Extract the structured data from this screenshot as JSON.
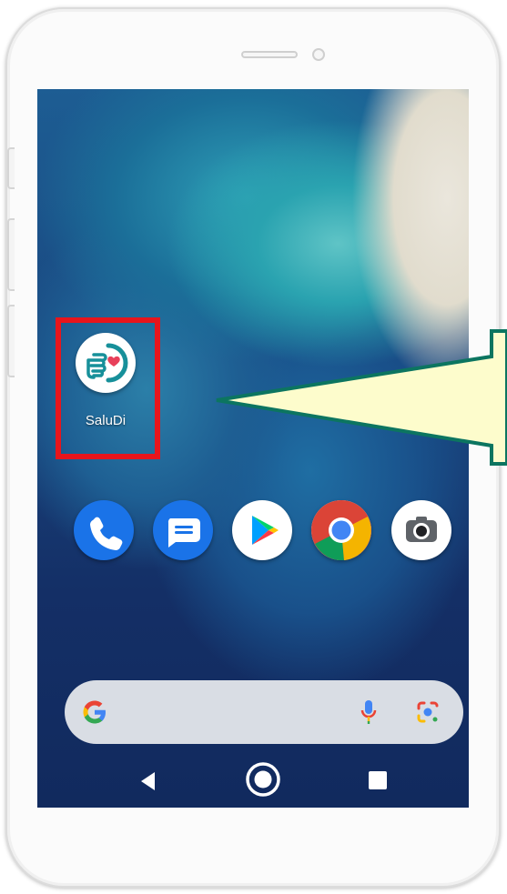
{
  "home_screen": {
    "app_shortcut": {
      "label": "SaluDi",
      "icon": "saludi-app-icon"
    },
    "dock": [
      {
        "icon": "phone-icon"
      },
      {
        "icon": "messages-icon"
      },
      {
        "icon": "play-store-icon"
      },
      {
        "icon": "chrome-icon"
      },
      {
        "icon": "camera-icon"
      }
    ],
    "search_bar": {
      "icons": [
        "google-g-icon",
        "microphone-icon",
        "lens-icon"
      ]
    },
    "nav": [
      "back-icon",
      "home-icon",
      "recents-icon"
    ]
  },
  "annotation": {
    "highlight_color": "#e8151c",
    "callout_fill": "#fdfccc",
    "callout_border": "#0c7560"
  },
  "colors": {
    "phone_blue": "#1a73e8",
    "saludi_teal": "#17909a",
    "saludi_heart": "#e8405a"
  }
}
